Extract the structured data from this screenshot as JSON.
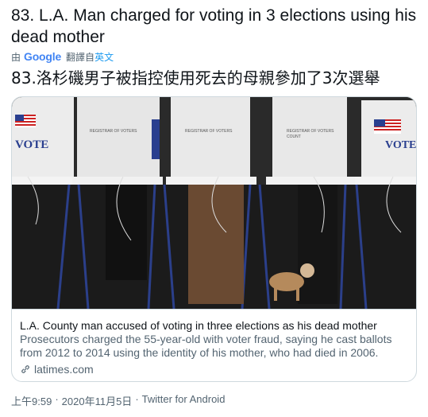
{
  "tweet": {
    "text": "83. L.A. Man charged for voting in 3 elections using his dead mother",
    "translation_prefix": "由",
    "translation_provider": "Google",
    "translation_action": "翻譯自",
    "translation_language": "英文",
    "translated_text": "83.洛杉磯男子被指控使用死去的母親參加了3次選舉"
  },
  "card": {
    "image_signs": {
      "vote": "VOTE",
      "registrar_line1": "REGISTRAR OF VOTERS",
      "registrar_line2": "COUNT"
    },
    "title": "L.A. County man accused of voting in three elections as his dead mother",
    "description": "Prosecutors charged the 55-year-old with voter fraud, saying he cast ballots from 2012 to 2014 using the identity of his mother, who had died in 2006.",
    "domain": "latimes.com"
  },
  "meta": {
    "time": "上午9:59",
    "separator": "·",
    "date": "2020年11月5日",
    "source": "Twitter for Android"
  },
  "colors": {
    "text": "#0f1419",
    "secondary": "#536471",
    "link": "#1d9bf0",
    "border": "#cfd9de"
  }
}
